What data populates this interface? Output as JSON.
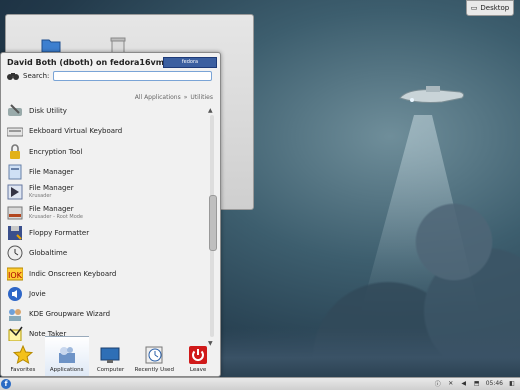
{
  "desktop": {
    "label": "Desktop"
  },
  "launcher": {
    "user": "David Both (dboth) on fedora16vm",
    "fedora_badge": "fedora",
    "search_label": "Search:",
    "search_value": "",
    "breadcrumb": {
      "root": "All Applications",
      "sep": "»",
      "current": "Utilities"
    },
    "items": [
      {
        "name": "Disk Utility",
        "icon": "disk-utility-icon",
        "sub": ""
      },
      {
        "name": "Eekboard Virtual Keyboard",
        "icon": "keyboard-icon",
        "sub": ""
      },
      {
        "name": "Encryption Tool",
        "icon": "padlock-icon",
        "sub": ""
      },
      {
        "name": "File Manager",
        "icon": "file-manager-icon",
        "sub": ""
      },
      {
        "name": "File Manager",
        "icon": "file-manager-krusader-icon",
        "sub": "Krusader"
      },
      {
        "name": "File Manager",
        "icon": "file-manager-root-icon",
        "sub": "Krusader - Root Mode"
      },
      {
        "name": "Floppy Formatter",
        "icon": "floppy-icon",
        "sub": ""
      },
      {
        "name": "Globaltime",
        "icon": "clock-icon",
        "sub": ""
      },
      {
        "name": "Indic Onscreen Keyboard",
        "icon": "iok-icon",
        "sub": ""
      },
      {
        "name": "Jovie",
        "icon": "speaker-icon",
        "sub": ""
      },
      {
        "name": "KDE Groupware Wizard",
        "icon": "groupware-wizard-icon",
        "sub": ""
      },
      {
        "name": "Note Taker",
        "icon": "notes-icon",
        "sub": ""
      }
    ],
    "tabs": [
      {
        "label": "Favorites",
        "icon": "star-icon"
      },
      {
        "label": "Applications",
        "icon": "applications-icon",
        "active": true
      },
      {
        "label": "Computer",
        "icon": "monitor-icon"
      },
      {
        "label": "Recently Used",
        "icon": "recent-clock-icon"
      },
      {
        "label": "Leave",
        "icon": "power-icon"
      }
    ]
  },
  "taskbar": {
    "launcher_glyph": "f",
    "clock": "05:46"
  }
}
